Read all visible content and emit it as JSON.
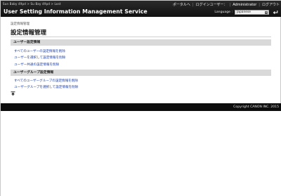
{
  "header": {
    "small_text": "Sun Baby 49pd > Su Bay 49pd > Lost",
    "title": "User Setting Information Management Service",
    "portal_link": "ポータルへ",
    "login_user_label": "ログインユーザー：",
    "login_user": "Administrator",
    "logout_link": "ログアウト",
    "language_label": "Language :",
    "language_value": "Japanese"
  },
  "breadcrumb": "設定情報管理",
  "page_title": "設定情報管理",
  "sections": [
    {
      "heading": "ユーザー設定情報",
      "links": [
        "すべてのユーザーの設定情報を削除",
        "ユーザーを選択して設定情報を削除",
        "ユーザー共通の設定情報を削除"
      ]
    },
    {
      "heading": "ユーザーグループ設定情報",
      "links": [
        "すべてのユーザーグループの設定情報を削除",
        "ユーザーグループを選択して設定情報を削除"
      ]
    }
  ],
  "footer": {
    "copyright": "Copyright CANON INC. 2015"
  },
  "icons": {
    "back": "return-arrow-icon",
    "top": "page-top-icon",
    "dropdown": "chevron-down-icon"
  }
}
